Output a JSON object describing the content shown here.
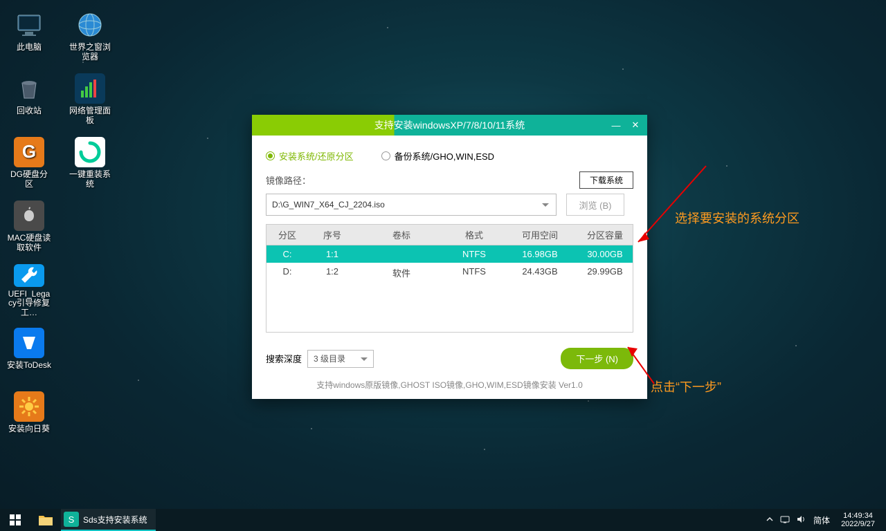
{
  "desktop_icons": {
    "this_pc": "此电脑",
    "browser": "世界之窗浏览器",
    "recycle": "回收站",
    "netpanel": "网络管理面板",
    "dg": "DG硬盘分区",
    "reinstall": "一键重装系统",
    "macread": "MAC硬盘读取软件",
    "uefi": "UEFI_Legacy引导修复工…",
    "todesk": "安装ToDesk",
    "sunflower": "安装向日葵"
  },
  "dialog": {
    "title": "支持安装windowsXP/7/8/10/11系统",
    "radio_install": "安装系统/还原分区",
    "radio_backup": "备份系统/GHO,WIN,ESD",
    "download_btn": "下载系统",
    "image_path_label": "镜像路径：",
    "image_path_value": "D:\\G_WIN7_X64_CJ_2204.iso",
    "browse_btn": "浏览 (B)",
    "headers": {
      "c1": "分区",
      "c2": "序号",
      "c3": "卷标",
      "c4": "格式",
      "c5": "可用空间",
      "c6": "分区容量"
    },
    "rows": [
      {
        "c1": "C:",
        "c2": "1:1",
        "c3": "",
        "c4": "NTFS",
        "c5": "16.98GB",
        "c6": "30.00GB"
      },
      {
        "c1": "D:",
        "c2": "1:2",
        "c3": "软件",
        "c4": "NTFS",
        "c5": "24.43GB",
        "c6": "29.99GB"
      }
    ],
    "depth_label": "搜索深度",
    "depth_value": "3 级目录",
    "next_btn": "下一步 (N)",
    "support_line": "支持windows原版镜像,GHOST ISO镜像,GHO,WIM,ESD镜像安装 Ver1.0"
  },
  "annotations": {
    "select_partition": "选择要安装的系统分区",
    "click_next": "点击“下一步”"
  },
  "taskbar": {
    "app_label": "Sds支持安装系统",
    "ime": "简体",
    "time": "14:49:34",
    "date": "2022/9/27"
  }
}
